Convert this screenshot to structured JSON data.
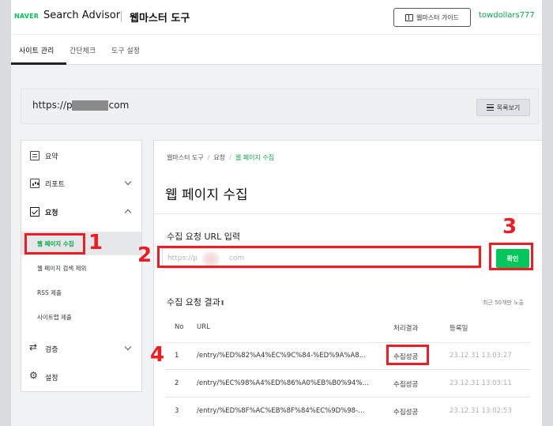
{
  "header": {
    "logo": "NAVER",
    "brand": "Search Advisor",
    "subtitle": "웹마스터 도구",
    "guide_button": "웹마스터 가이드",
    "username": "towdollars777"
  },
  "tabs": [
    {
      "label": "사이트 관리",
      "active": true
    },
    {
      "label": "간단체크",
      "active": false
    },
    {
      "label": "도구 설정",
      "active": false
    }
  ],
  "site": {
    "url_prefix": "https://p",
    "url_suffix": "com",
    "list_button": "목록보기"
  },
  "sidebar": {
    "items": [
      {
        "label": "요약",
        "icon": "document-icon"
      },
      {
        "label": "리포트",
        "icon": "chart-icon"
      },
      {
        "label": "요청",
        "icon": "check-icon"
      },
      {
        "label": "검증",
        "icon": "swap-icon"
      },
      {
        "label": "설정",
        "icon": "gear-icon"
      }
    ],
    "sub_items": [
      {
        "label": "웹 페이지 수집",
        "active": true
      },
      {
        "label": "웹 페이지 검색 제외",
        "active": false
      },
      {
        "label": "RSS 제출",
        "active": false
      },
      {
        "label": "사이트맵 제출",
        "active": false
      }
    ]
  },
  "main": {
    "breadcrumb": [
      "웹마스터 도구",
      "요청",
      "웹 페이지 수집"
    ],
    "title": "웹 페이지 수집",
    "url_label": "수집 요청 URL 입력",
    "url_value_prefix": "https://p",
    "url_value_suffix": "com",
    "confirm_button": "확인",
    "result_title": "수집 요청 결과",
    "result_note": "최근 50개만 노출",
    "columns": [
      "No",
      "URL",
      "처리결과",
      "등록일"
    ],
    "rows": [
      {
        "no": "1",
        "url": "/entry/%ED%82%A4%EC%9C%84-%ED%9A%A8…",
        "status": "수집성공",
        "date": "23.12.31 13:03:27"
      },
      {
        "no": "2",
        "url": "/entry/%EC%98%A4%ED%86%A0%EB%B0%94%…",
        "status": "수집성공",
        "date": "23.12.31 13:03:11"
      },
      {
        "no": "3",
        "url": "/entry/%ED%8F%AC%EB%8F%84%EC%9D%98-…",
        "status": "수집성공",
        "date": "23.12.31 13:02:53"
      }
    ]
  },
  "annotations": [
    "1",
    "2",
    "3",
    "4"
  ],
  "colors": {
    "accent": "#03c75a",
    "annotation": "#ee1c25"
  }
}
